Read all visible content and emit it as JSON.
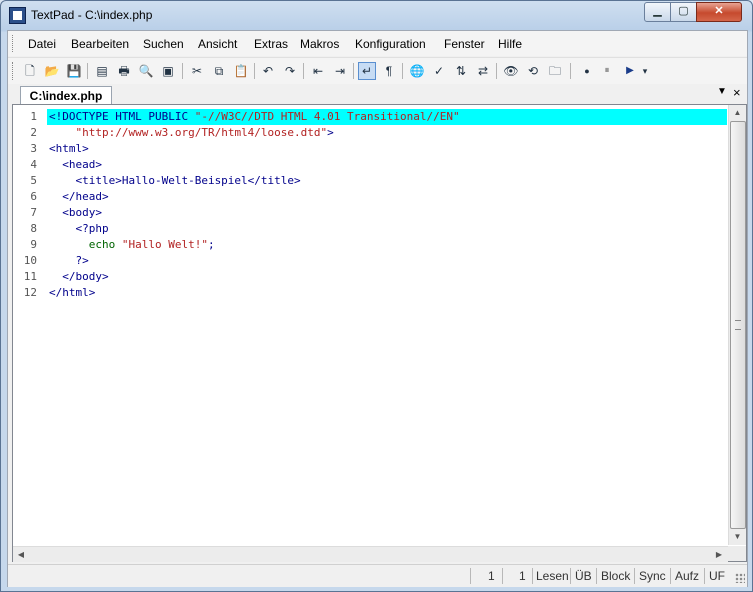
{
  "window": {
    "title": "TextPad - C:\\index.php"
  },
  "titlebar": {
    "min_icon": "minimize-icon",
    "max_icon": "maximize-icon",
    "close_icon": "close-icon",
    "min_glyph": "▁",
    "max_glyph": "▢",
    "close_glyph": "✕"
  },
  "menu": [
    "Datei",
    "Bearbeiten",
    "Suchen",
    "Ansicht",
    "Extras",
    "Makros",
    "Konfiguration",
    "Fenster",
    "Hilfe"
  ],
  "toolbar": [
    {
      "icon": "new-file-icon",
      "glyph": "🗋"
    },
    {
      "icon": "open-folder-icon",
      "glyph": "📂"
    },
    {
      "icon": "save-icon",
      "glyph": "💾"
    },
    {
      "icon": "save-all-icon",
      "glyph": "▤"
    },
    {
      "icon": "print-icon",
      "glyph": "🖶"
    },
    {
      "icon": "print-preview-icon",
      "glyph": "🔍"
    },
    {
      "icon": "manage-files-icon",
      "glyph": "▣"
    },
    {
      "icon": "cut-icon",
      "glyph": "✂"
    },
    {
      "icon": "copy-icon",
      "glyph": "⧉"
    },
    {
      "icon": "paste-icon",
      "glyph": "📋"
    },
    {
      "icon": "undo-icon",
      "glyph": "↶"
    },
    {
      "icon": "redo-icon",
      "glyph": "↷"
    },
    {
      "icon": "outdent-icon",
      "glyph": "⇤"
    },
    {
      "icon": "indent-icon",
      "glyph": "⇥"
    },
    {
      "icon": "word-wrap-icon",
      "glyph": "↵"
    },
    {
      "icon": "show-formatting-icon",
      "glyph": "¶"
    },
    {
      "icon": "web-browser-icon",
      "glyph": "🌐"
    },
    {
      "icon": "spell-check-icon",
      "glyph": "✓"
    },
    {
      "icon": "sort-icon",
      "glyph": "⇅"
    },
    {
      "icon": "compare-icon",
      "glyph": "⇄"
    },
    {
      "icon": "find-icon",
      "glyph": "👁"
    },
    {
      "icon": "replace-icon",
      "glyph": "⟲"
    },
    {
      "icon": "find-in-files-icon",
      "glyph": "🗀"
    },
    {
      "icon": "record-macro-icon",
      "glyph": "●"
    },
    {
      "icon": "pause-macro-icon",
      "glyph": "⏸"
    },
    {
      "icon": "play-macro-icon",
      "glyph": "▶"
    },
    {
      "icon": "toolbar-options-icon",
      "glyph": "▾"
    }
  ],
  "tabs": [
    {
      "label": "C:\\index.php"
    }
  ],
  "tab_controls": {
    "dropdown_glyph": "▼",
    "close_glyph": "×"
  },
  "editor": {
    "highlight_line": 1,
    "lines": [
      {
        "num": "1",
        "parts": [
          {
            "t": "<!DOCTYPE HTML PUBLIC ",
            "c": "tag"
          },
          {
            "t": "\"-//W3C//DTD HTML 4.01 Transitional//EN\"",
            "c": "str"
          }
        ]
      },
      {
        "num": "2",
        "parts": [
          {
            "t": "    ",
            "c": "tag"
          },
          {
            "t": "\"http://www.w3.org/TR/html4/loose.dtd\"",
            "c": "str"
          },
          {
            "t": ">",
            "c": "tag"
          }
        ]
      },
      {
        "num": "3",
        "parts": [
          {
            "t": "<html>",
            "c": "tag"
          }
        ]
      },
      {
        "num": "4",
        "parts": [
          {
            "t": "  <head>",
            "c": "tag"
          }
        ]
      },
      {
        "num": "5",
        "parts": [
          {
            "t": "    <title>Hallo-Welt-Beispiel</title>",
            "c": "tag"
          }
        ]
      },
      {
        "num": "6",
        "parts": [
          {
            "t": "  </head>",
            "c": "tag"
          }
        ]
      },
      {
        "num": "7",
        "parts": [
          {
            "t": "  <body>",
            "c": "tag"
          }
        ]
      },
      {
        "num": "8",
        "parts": [
          {
            "t": "    <?php",
            "c": "tag"
          }
        ]
      },
      {
        "num": "9",
        "parts": [
          {
            "t": "      ",
            "c": "tag"
          },
          {
            "t": "echo",
            "c": "kw"
          },
          {
            "t": " ",
            "c": "tag"
          },
          {
            "t": "\"Hallo Welt!\"",
            "c": "str"
          },
          {
            "t": ";",
            "c": "tag"
          }
        ]
      },
      {
        "num": "10",
        "parts": [
          {
            "t": "    ?>",
            "c": "tag"
          }
        ]
      },
      {
        "num": "11",
        "parts": [
          {
            "t": "  </body>",
            "c": "tag"
          }
        ]
      },
      {
        "num": "12",
        "parts": [
          {
            "t": "</html>",
            "c": "tag"
          }
        ]
      }
    ]
  },
  "scrollbars": {
    "up_glyph": "▲",
    "down_glyph": "▼",
    "left_glyph": "◀",
    "right_glyph": "▶"
  },
  "status": {
    "line": "1",
    "column": "1",
    "mode": "Lesen",
    "overwrite": "ÜB",
    "block": "Block",
    "sync": "Sync",
    "record": "Aufz",
    "uf": "UF"
  }
}
